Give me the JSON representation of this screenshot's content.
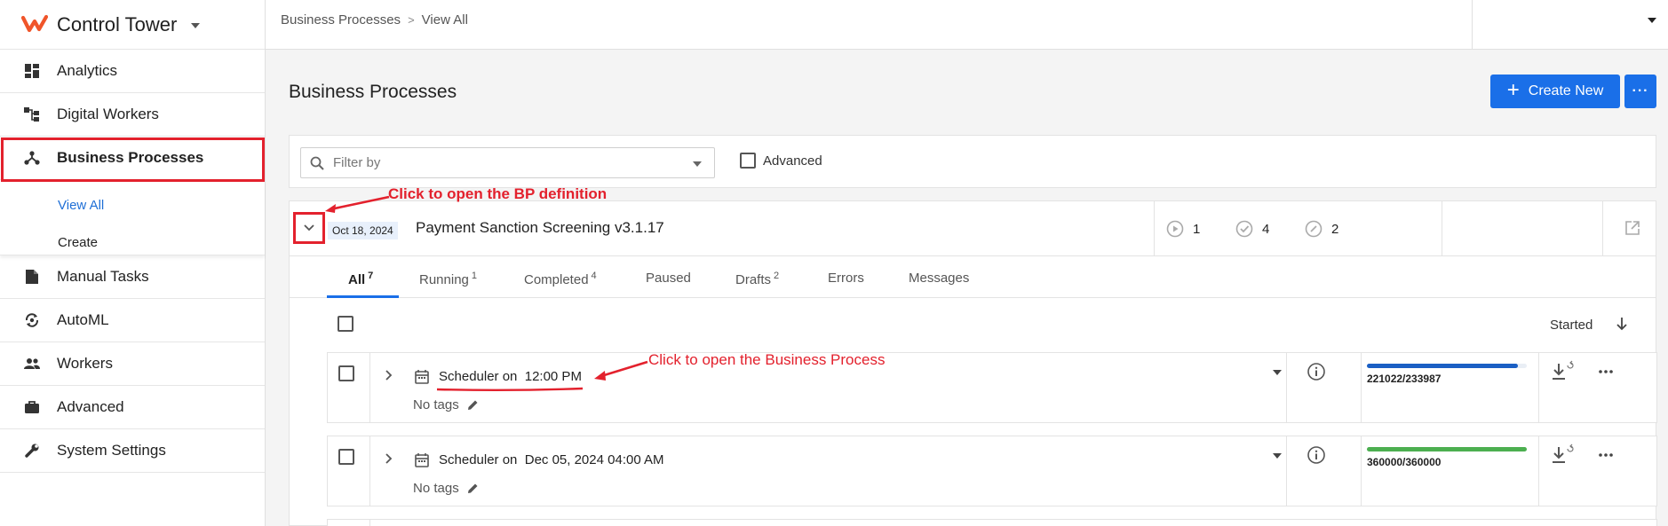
{
  "app": {
    "title": "Control Tower"
  },
  "sidebar": {
    "items": [
      {
        "label": "Analytics",
        "icon": "dashboard-icon"
      },
      {
        "label": "Digital Workers",
        "icon": "hierarchy-icon"
      },
      {
        "label": "Business Processes",
        "icon": "process-icon",
        "active": true
      },
      {
        "label": "Manual Tasks",
        "icon": "document-icon"
      },
      {
        "label": "AutoML",
        "icon": "automl-icon"
      },
      {
        "label": "Workers",
        "icon": "people-icon"
      },
      {
        "label": "Advanced",
        "icon": "briefcase-icon"
      },
      {
        "label": "System Settings",
        "icon": "wrench-icon"
      }
    ],
    "subitems": [
      {
        "label": "View All",
        "active": true
      },
      {
        "label": "Create"
      }
    ]
  },
  "breadcrumb": [
    "Business Processes",
    "View All"
  ],
  "page": {
    "title": "Business Processes",
    "create_label": "Create New",
    "more_label": "···"
  },
  "filter": {
    "placeholder": "Filter by",
    "advanced_label": "Advanced"
  },
  "bp": {
    "date": "Oct 18, 2024",
    "title": "Payment Sanction Screening v3.1.17",
    "stats": {
      "running": "1",
      "completed": "4",
      "drafts": "2"
    }
  },
  "tabs": [
    {
      "label": "All",
      "count": "7",
      "active": true
    },
    {
      "label": "Running",
      "count": "1"
    },
    {
      "label": "Completed",
      "count": "4"
    },
    {
      "label": "Paused",
      "count": ""
    },
    {
      "label": "Drafts",
      "count": "2"
    },
    {
      "label": "Errors",
      "count": ""
    },
    {
      "label": "Messages",
      "count": ""
    }
  ],
  "list": {
    "sort_label": "Started",
    "rows": [
      {
        "schedule": "Scheduler on  12:00 PM",
        "tags": "No tags",
        "progress_text": "221022/233987",
        "progress": 0.945,
        "color": "#1a5fc4"
      },
      {
        "schedule": "Scheduler on  Dec 05, 2024 04:00 AM",
        "tags": "No tags",
        "progress_text": "360000/360000",
        "progress": 1.0,
        "color": "#4caf50"
      }
    ]
  },
  "annotations": {
    "bp_definition": "Click to open the BP definition",
    "business_process": "Click to open the Business Process",
    "color": "#e3212d"
  }
}
